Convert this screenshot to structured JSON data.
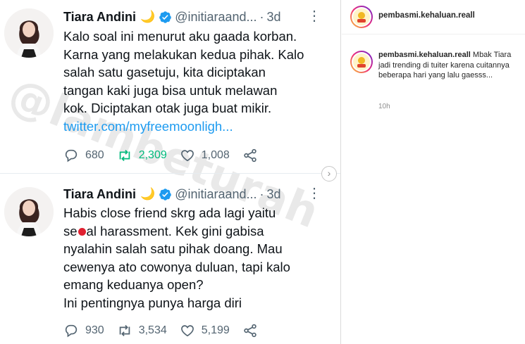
{
  "tweets": [
    {
      "name": "Tiara Andini",
      "emoji": "🌙",
      "handle": "@initiaraand...",
      "separator": "·",
      "time": "3d",
      "lines": [
        "Kalo soal ini menurut aku gaada korban.",
        "Karna yang melakukan kedua pihak. Kalo",
        "salah satu gasetuju, kita diciptakan",
        "tangan kaki juga bisa untuk melawan",
        "kok. Diciptakan otak juga buat mikir."
      ],
      "link": "twitter.com/myfreemoonligh...",
      "replies": "680",
      "retweets": "2,309",
      "likes": "1,008"
    },
    {
      "name": "Tiara Andini",
      "emoji": "🌙",
      "handle": "@initiaraand...",
      "separator": "·",
      "time": "3d",
      "line1": "Habis close friend skrg ada lagi yaitu",
      "line2_pre": "se",
      "line2_post": "al harassment. Kek gini gabisa",
      "lines_rest": [
        "nyalahin salah satu pihak doang. Mau",
        "cewenya ato cowonya duluan, tapi kalo",
        "emang keduanya open?",
        "Ini pentingnya punya harga diri"
      ],
      "replies": "930",
      "retweets": "3,534",
      "likes": "5,199"
    }
  ],
  "watermark": "@lambeturah",
  "colors": {
    "link": "#1d9bf0",
    "verified": "#1d9bf0",
    "retweet_active": "#00ba7c",
    "muted": "#536471",
    "redaction": "#e02030"
  },
  "instagram": {
    "username": "pembasmi.kehaluan.reall",
    "comment": {
      "username": "pembasmi.kehaluan.reall",
      "text": "Mbak Tiara jadi trending di tuiter karena cuitannya beberapa hari yang lalu gaesss...",
      "time": "10h"
    }
  },
  "icons": {
    "reply": "reply-icon",
    "retweet": "retweet-icon",
    "like": "heart-icon",
    "share": "share-icon",
    "more": "more-icon",
    "verified": "verified-badge-icon",
    "next": "chevron-right-icon"
  }
}
